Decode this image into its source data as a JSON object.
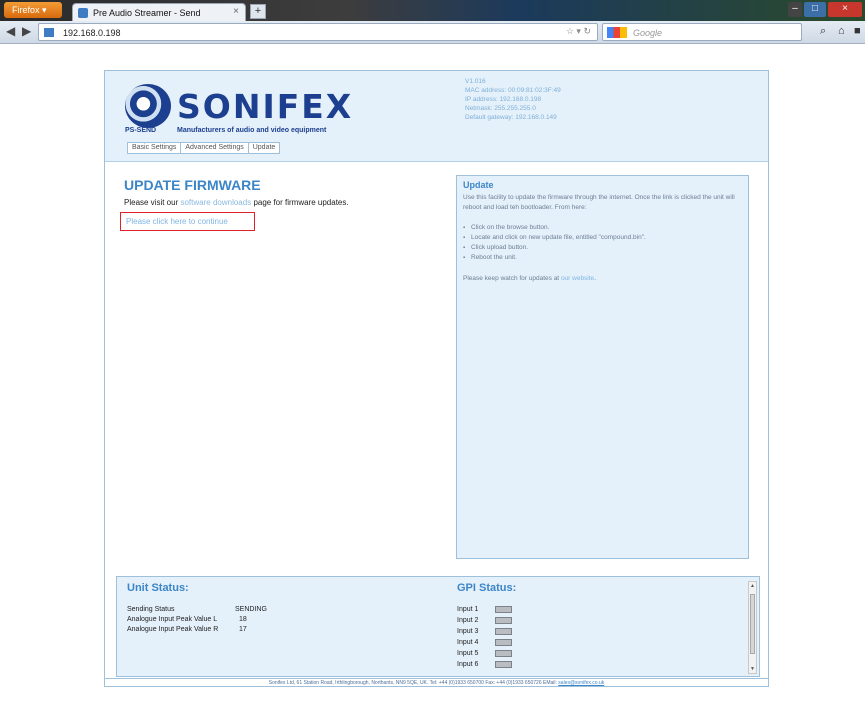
{
  "browser": {
    "app_button": "Firefox",
    "tab_title": "Pre Audio Streamer - Send",
    "new_tab": "+",
    "url": "192.168.0.198",
    "search_placeholder": "Google"
  },
  "header": {
    "brand": "SONIFEX",
    "product": "PS-SEND",
    "tagline": "Manufacturers of audio and video equipment",
    "version": "V1.016",
    "mac": "MAC address: 00:09:81:02:3F:49",
    "ip": "IP address: 192.168.0.198",
    "netmask": "Netmask: 255.255.255.0",
    "gateway": "Default gateway: 192.168.0.149",
    "tabs": [
      "Basic Settings",
      "Advanced Settings",
      "Update"
    ]
  },
  "main": {
    "title": "UPDATE FIRMWARE",
    "visit_prefix": "Please visit our",
    "visit_link": "software downloads",
    "visit_suffix": "page for firmware updates.",
    "continue_link": "Please click here to continue"
  },
  "update_panel": {
    "title": "Update",
    "description": "Use this facility to update the firmware through the internet. Once the link is clicked the unit will reboot and load teh bootloader. From here:",
    "steps": [
      "Click on the browse button.",
      "Locate and click on new update file, entitled \"compound.bin\".",
      "Click upload button.",
      "Reboot the unit."
    ],
    "keep_prefix": "Please keep watch for updates at",
    "keep_link": "our website"
  },
  "status": {
    "unit_title": "Unit Status:",
    "unit_rows": [
      {
        "label": "Sending Status",
        "value": "SENDING"
      },
      {
        "label": "Analogue Input Peak Value L",
        "value": "18"
      },
      {
        "label": "Analogue Input Peak Value R",
        "value": "17"
      }
    ],
    "gpi_title": "GPI Status:",
    "gpi_inputs": [
      "Input 1",
      "Input 2",
      "Input 3",
      "Input 4",
      "Input 5",
      "Input 6"
    ]
  },
  "footer": {
    "text": "Sonifex Ltd, 61 Station Road, Irthlingborough, Northants, NN9 5QE, UK. Tel: +44 (0)1933 650700 Fax: +44 (0)1933 650726 EMail:",
    "email": "sales@sonifex.co.uk"
  },
  "colors": {
    "accent": "#3c86c8",
    "panel": "#e4f0fa",
    "highlight_box": "#e0222b"
  }
}
